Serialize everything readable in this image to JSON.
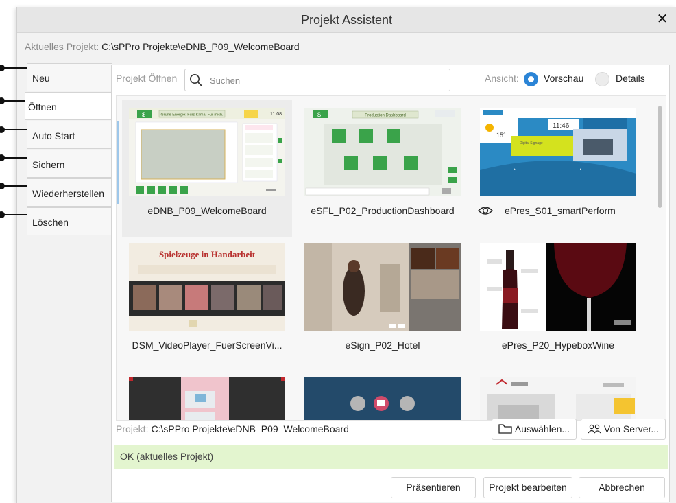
{
  "dialog": {
    "title": "Projekt Assistent",
    "current_project_label": "Aktuelles Projekt:",
    "current_project_path": "C:\\sPPro Projekte\\eDNB_P09_WelcomeBoard"
  },
  "tabs": [
    {
      "label": "Neu",
      "active": false
    },
    {
      "label": "Öffnen",
      "active": true
    },
    {
      "label": "Auto Start",
      "active": false
    },
    {
      "label": "Sichern",
      "active": false
    },
    {
      "label": "Wiederherstellen",
      "active": false
    },
    {
      "label": "Löschen",
      "active": false
    }
  ],
  "open_panel": {
    "title": "Projekt Öffnen",
    "search_placeholder": "Suchen",
    "view_label": "Ansicht:",
    "view_options": [
      "Vorschau",
      "Details"
    ],
    "selected_view": "Vorschau"
  },
  "projects": [
    {
      "name": "eDNB_P09_WelcomeBoard",
      "selected": true
    },
    {
      "name": "eSFL_P02_ProductionDashboard"
    },
    {
      "name": "ePres_S01_smartPerform",
      "icon": "eye-icon"
    },
    {
      "name": "DSM_VideoPlayer_FuerScreenVi..."
    },
    {
      "name": "eSign_P02_Hotel"
    },
    {
      "name": "ePres_P20_HypeboxWine"
    },
    {
      "name": ""
    },
    {
      "name": ""
    },
    {
      "name": ""
    }
  ],
  "thumb_text": {
    "t1_banner": "Grüne Energie: Fürs Klima. Für mich.",
    "t1_time": "11:08",
    "t2_banner": "Production Dashboard",
    "t3_time": "11:46",
    "t3_temp": "15°",
    "t3_box": "Digital Signage",
    "t4_title": "Spielzeuge in Handarbeit"
  },
  "footer": {
    "project_label": "Projekt:",
    "project_path": "C:\\sPPro Projekte\\eDNB_P09_WelcomeBoard",
    "select_button": "Auswählen...",
    "server_button": "Von Server..."
  },
  "status": "OK (aktuelles Projekt)",
  "actions": {
    "present": "Präsentieren",
    "edit": "Projekt bearbeiten",
    "cancel": "Abbrechen"
  },
  "colors": {
    "accent": "#2b84d6",
    "status_bg": "#e3f5cf",
    "green_tile": "#3aa34a"
  }
}
